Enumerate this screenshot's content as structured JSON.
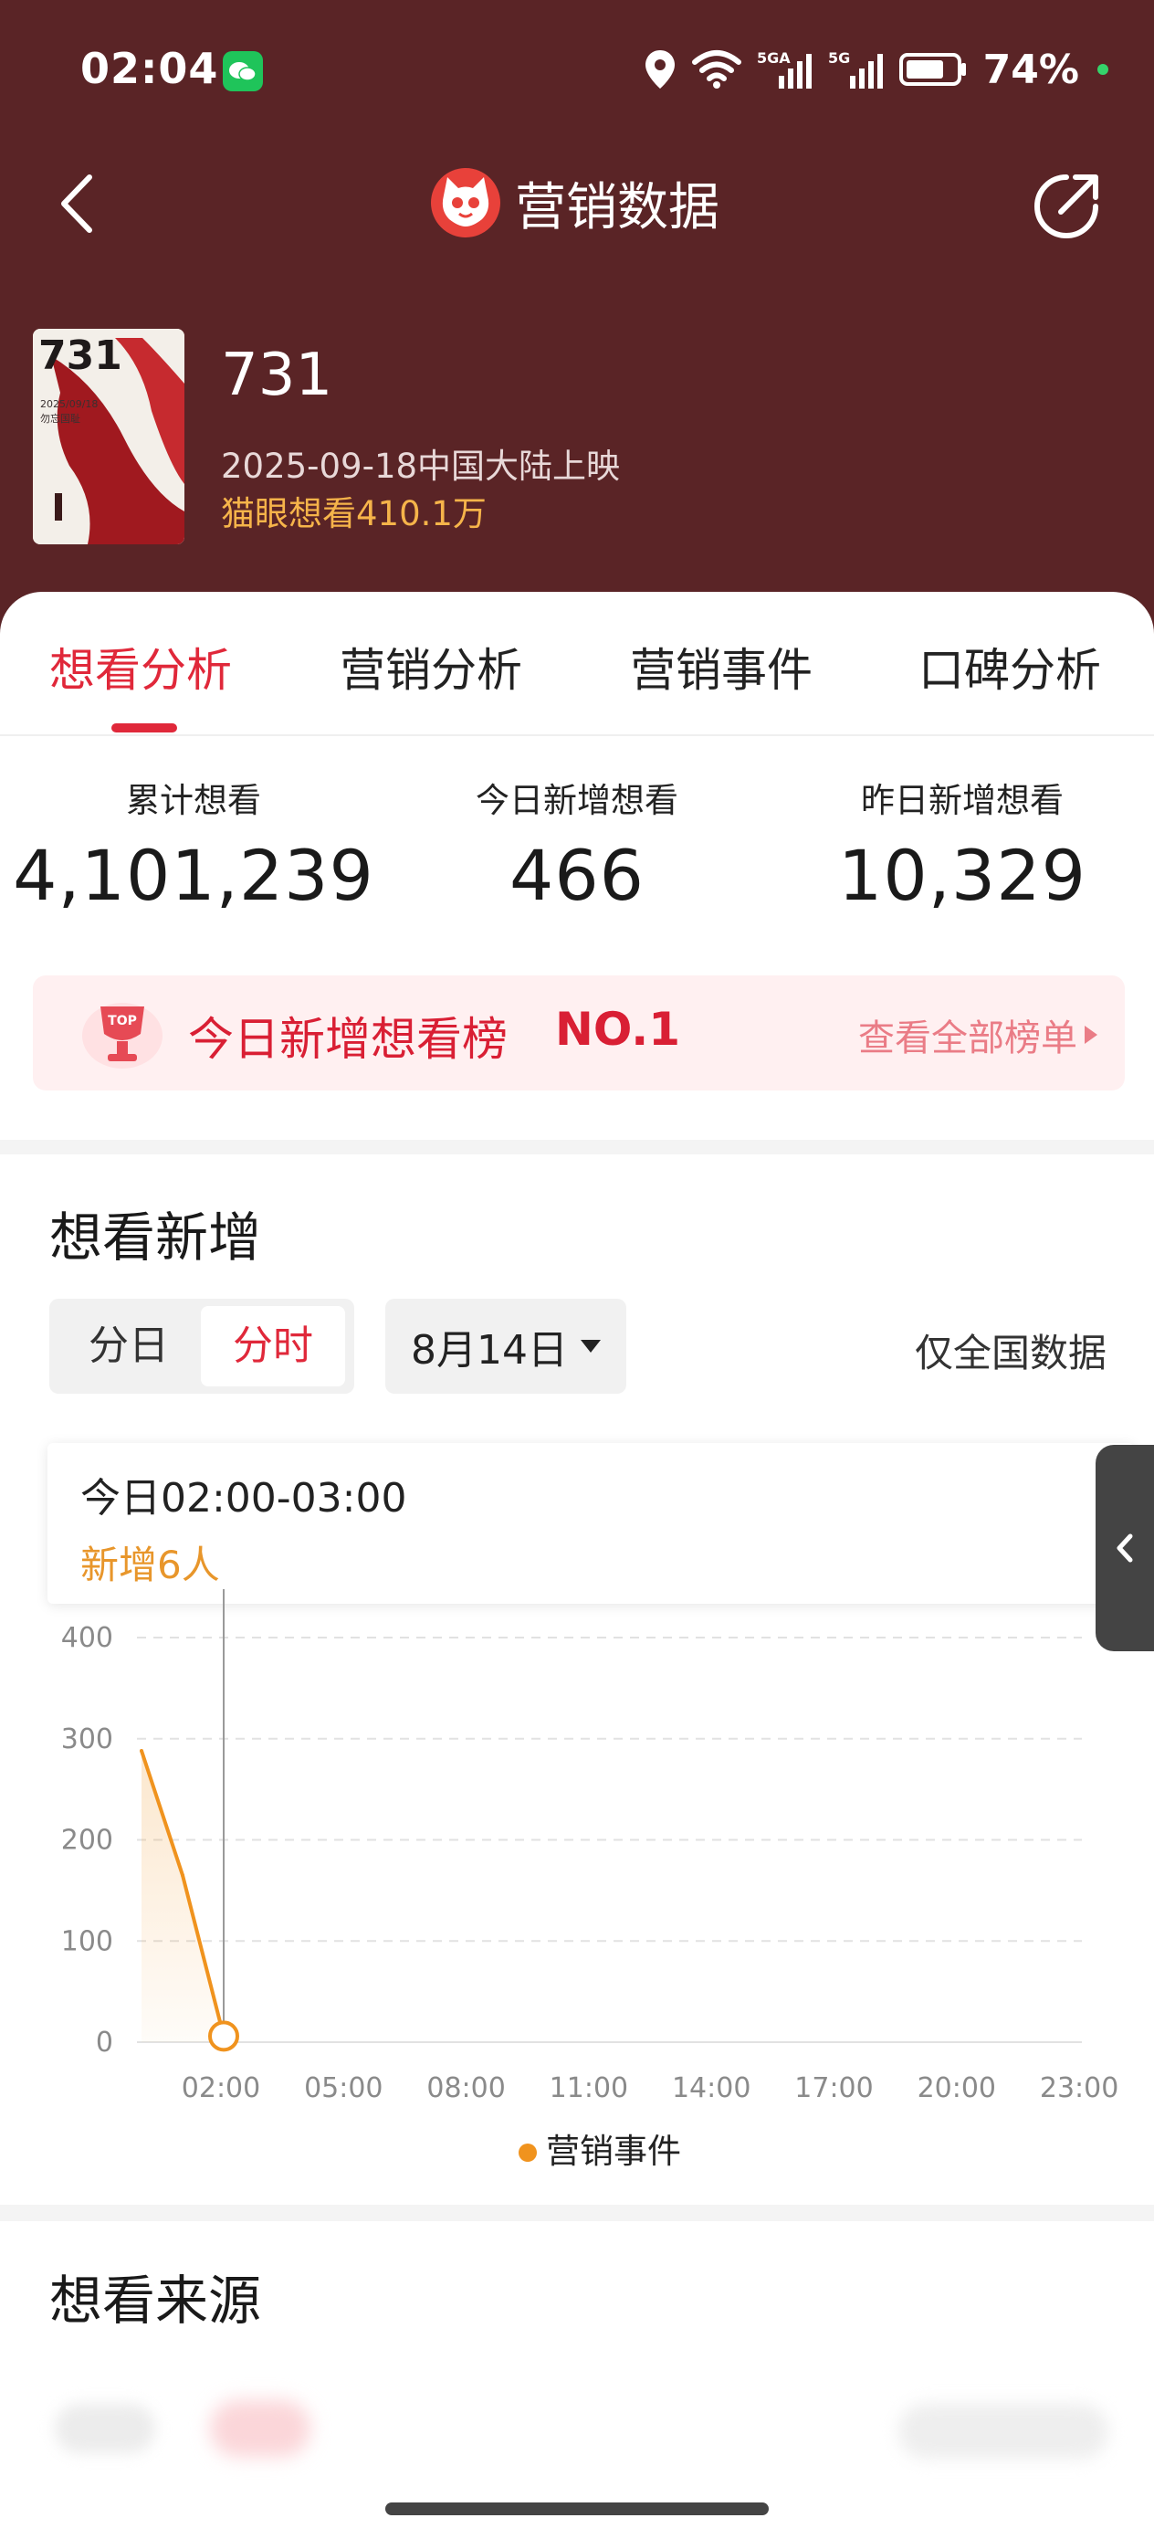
{
  "status_bar": {
    "time": "02:04",
    "battery": "74%",
    "icons": [
      "wechat-icon",
      "location-icon",
      "wifi-icon",
      "signal-5ga-icon",
      "signal-5g-icon",
      "battery-icon"
    ]
  },
  "nav": {
    "title": "营销数据",
    "back_icon": "chevron-left-icon",
    "share_icon": "share-arrow-icon",
    "logo_icon": "maoyan-cat-logo"
  },
  "movie": {
    "title": "731",
    "release": "2025-09-18中国大陆上映",
    "want_count": "猫眼想看410.1万",
    "poster": {
      "title": "731",
      "date": "2025/09/18",
      "tagline": "勿忘国耻"
    }
  },
  "tabs": [
    {
      "label": "想看分析",
      "active": true
    },
    {
      "label": "营销分析",
      "active": false
    },
    {
      "label": "营销事件",
      "active": false
    },
    {
      "label": "口碑分析",
      "active": false
    }
  ],
  "stats": [
    {
      "label": "累计想看",
      "value": "4,101,239"
    },
    {
      "label": "今日新增想看",
      "value": "466"
    },
    {
      "label": "昨日新增想看",
      "value": "10,329"
    }
  ],
  "ranking": {
    "badge": "TOP",
    "title": "今日新增想看榜",
    "rank": "NO.1",
    "link": "查看全部榜单"
  },
  "want_new": {
    "title": "想看新增",
    "toggle": [
      {
        "label": "分日",
        "active": false
      },
      {
        "label": "分时",
        "active": true
      }
    ],
    "date": "8月14日",
    "scope": "仅全国数据",
    "tooltip": {
      "time": "今日02:00-03:00",
      "count": "新增6人"
    }
  },
  "chart_data": {
    "type": "line",
    "title": "",
    "xlabel": "",
    "ylabel": "",
    "ylim": [
      0,
      400
    ],
    "yticks": [
      400,
      300,
      200,
      100,
      0
    ],
    "xticks": [
      "02:00",
      "05:00",
      "08:00",
      "11:00",
      "14:00",
      "17:00",
      "20:00",
      "23:00"
    ],
    "x": [
      0,
      1,
      2
    ],
    "series": [
      {
        "values": [
          288,
          165,
          6
        ],
        "color": "#f0931e"
      }
    ],
    "selected_x": 2,
    "legend": {
      "label": "营销事件",
      "color": "#f0931e",
      "placement": "bottom"
    },
    "grid": true
  },
  "source": {
    "title": "想看来源"
  }
}
